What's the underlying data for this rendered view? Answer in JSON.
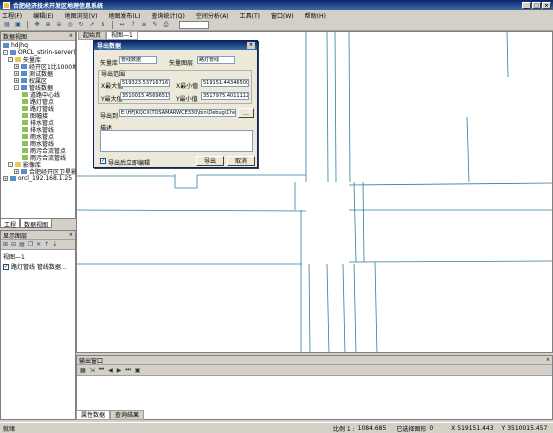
{
  "window": {
    "title": "合肥经济技术开发区地理信息系统"
  },
  "menu": [
    "工程(F)",
    "编辑(E)",
    "地图浏览(V)",
    "地图发布(L)",
    "查询统计(Q)",
    "空间分析(A)",
    "工具(T)",
    "窗口(W)",
    "帮助(H)"
  ],
  "toolbar_icons": [
    "open-icon",
    "save-icon",
    "pan-icon",
    "zoom-in-icon",
    "zoom-out-icon",
    "full-extent-icon",
    "refresh-icon",
    "select-icon",
    "identify-icon",
    "measure-icon",
    "query-icon",
    "layer-icon",
    "edit-icon",
    "print-icon"
  ],
  "catalog": {
    "title": "数据视图",
    "items": [
      "hdjhq",
      "ORCL_stirin-server(hdjhq)",
      "矢量库",
      "经开区1比1000地形",
      "测试数据",
      "权属区",
      "管线数据",
      "道路中心线",
      "路灯管点",
      "路灯管线",
      "图幅接",
      "排水管点",
      "排水管线",
      "雨水管点",
      "雨水管线",
      "雨污合流管点",
      "雨污合流管线",
      "影像库",
      "合肥经开区卫星影像",
      "orcl_192.168.1.25"
    ]
  },
  "left_tabs": [
    "工程",
    "数据视图"
  ],
  "layers": {
    "title": "显示图层",
    "view_name": "视图—1",
    "item": "路灯管线 管线数据..."
  },
  "map_tabs": [
    "起始页",
    "视图—1"
  ],
  "dialog": {
    "title": "导出数据",
    "vector_library_label": "矢量库",
    "vector_library_value": "管线数据",
    "vector_layer_label": "矢量图层",
    "vector_layer_value": "路灯管线",
    "extent_group_label": "导出范围",
    "xmax_label": "X最大值",
    "xmax_value": "519323.537167167",
    "xmin_label": "X最小值",
    "xmin_value": "519151.443465007",
    "ymax_label": "Y最大值",
    "ymax_value": "3510015.45696515",
    "ymin_label": "Y最小值",
    "ymin_value": "3517975.40111128",
    "export_to_label": "导出到",
    "export_to_value": "E:\\HFJKQCX\\TOSAMARWCE330\\bin\\Debug\\Check\\",
    "browse_label": "...",
    "description_label": "描述",
    "auto_close_label": "导出后立即编辑",
    "ok_label": "导出",
    "cancel_label": "取消"
  },
  "output": {
    "title": "输出窗口",
    "tabs": [
      "属性数据",
      "查询结果"
    ]
  },
  "status": {
    "ready": "就绪",
    "scale_label": "比例 1 :",
    "scale_value": "1084.685",
    "selected_label": "已选择图形",
    "selected_value": "0",
    "x_label": "X",
    "x_value": "519151.443",
    "y_label": "Y",
    "y_value": "3510015.457"
  },
  "colors": {
    "accent": "#0a246a",
    "map_line": "#2e7fa0",
    "panel_bg": "#d4d0c8"
  }
}
